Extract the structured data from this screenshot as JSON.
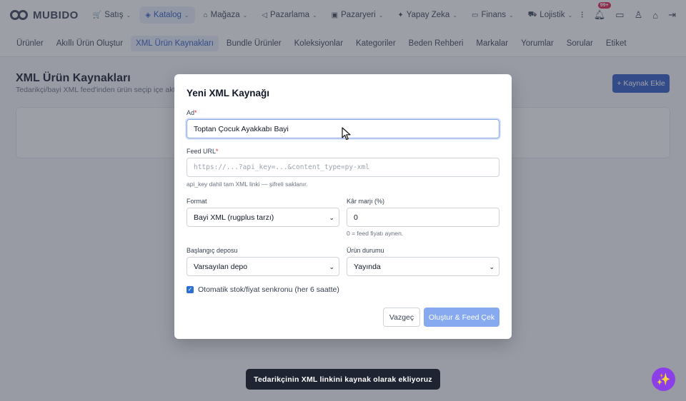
{
  "brand": {
    "name": "MUBIDO"
  },
  "main_nav": [
    {
      "label": "Satış",
      "icon": "cart-icon",
      "glyph": "🛒"
    },
    {
      "label": "Katalog",
      "icon": "box-icon",
      "glyph": "◈"
    },
    {
      "label": "Mağaza",
      "icon": "store-icon",
      "glyph": "⌂"
    },
    {
      "label": "Pazarlama",
      "icon": "megaphone-icon",
      "glyph": "◁"
    },
    {
      "label": "Pazaryeri",
      "icon": "marketplace-icon",
      "glyph": "▣"
    },
    {
      "label": "Yapay Zeka",
      "icon": "sparkle-icon",
      "glyph": "✦"
    },
    {
      "label": "Finans",
      "icon": "wallet-icon",
      "glyph": "▭"
    },
    {
      "label": "Lojistik",
      "icon": "truck-icon",
      "glyph": "⛟"
    }
  ],
  "main_nav_active": "Katalog",
  "notifications": {
    "badge": "99+"
  },
  "sub_nav": [
    "Ürünler",
    "Akıllı Ürün Oluştur",
    "XML Ürün Kaynakları",
    "Bundle Ürünler",
    "Koleksiyonlar",
    "Kategoriler",
    "Beden Rehberi",
    "Markalar",
    "Yorumlar",
    "Sorular",
    "Etiket"
  ],
  "sub_nav_active": "XML Ürün Kaynakları",
  "page": {
    "title": "XML Ürün Kaynakları",
    "subtitle": "Tedarikçi/bayi XML feed'inden ürün seçip içe akt",
    "add_button": "+ Kaynak Ekle"
  },
  "modal": {
    "title": "Yeni XML Kaynağı",
    "name_label": "Ad",
    "name_value": "Toptan Çocuk Ayakkabı Bayi",
    "url_label": "Feed URL",
    "url_placeholder": "https://...?api_key=...&content_type=py-xml",
    "url_hint": "api_key dahil tam XML linki — şifreli saklanır.",
    "format_label": "Format",
    "format_value": "Bayi XML (rugplus tarzı)",
    "margin_label": "Kâr marjı (%)",
    "margin_value": "0",
    "margin_hint": "0 = feed fiyatı aynen.",
    "warehouse_label": "Başlangıç deposu",
    "warehouse_value": "Varsayılan depo",
    "status_label": "Ürün durumu",
    "status_value": "Yayında",
    "auto_sync_label": "Otomatik stok/fiyat senkronu (her 6 saatte)",
    "auto_sync_checked": true,
    "cancel_button": "Vazgeç",
    "submit_button": "Oluştur & Feed Çek"
  },
  "toast": {
    "text": "Tedarikçinin XML linkini kaynak olarak ekliyoruz"
  },
  "colors": {
    "primary": "#2b59c3",
    "primary_disabled": "#86a9ef",
    "fab": "#8b3fe8",
    "badge": "#e11d48"
  }
}
